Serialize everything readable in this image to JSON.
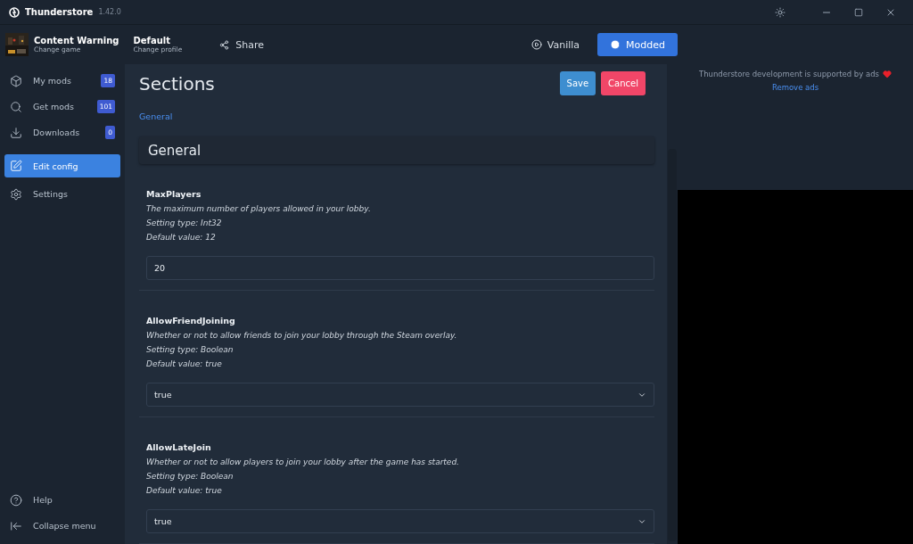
{
  "window": {
    "title": "Thunderstore",
    "version": "1.42.0"
  },
  "game": {
    "name": "Content Warning",
    "action": "Change game"
  },
  "profile": {
    "name": "Default",
    "action": "Change profile"
  },
  "share": "Share",
  "launch": [
    {
      "label": "Vanilla",
      "selected": false
    },
    {
      "label": "Modded",
      "selected": true
    }
  ],
  "sidebar": {
    "items": [
      {
        "kind": "mods",
        "label": "My mods",
        "badge": "18",
        "selected": false
      },
      {
        "kind": "search",
        "label": "Get mods",
        "badge": "101",
        "selected": false
      },
      {
        "kind": "download",
        "label": "Downloads",
        "badge": "0",
        "selected": false
      },
      {
        "kind": "edit",
        "label": "Edit config",
        "selected": true
      },
      {
        "kind": "settings",
        "label": "Settings",
        "selected": false
      }
    ],
    "footer": [
      {
        "kind": "help",
        "label": "Help"
      },
      {
        "kind": "collapse",
        "label": "Collapse menu"
      }
    ]
  },
  "content": {
    "title": "Sections",
    "buttons": [
      {
        "kind": "save",
        "label": "Save"
      },
      {
        "kind": "cancel",
        "label": "Cancel"
      }
    ],
    "section_links": [
      "General"
    ],
    "section_title": "General",
    "settings": [
      {
        "name": "MaxPlayers",
        "description": "The maximum number of players allowed in your lobby.",
        "type": "Setting type: Int32",
        "default": "Default value: 12",
        "kind": "input",
        "value": "20"
      },
      {
        "name": "AllowFriendJoining",
        "description": "Whether or not to allow friends to join your lobby through the Steam overlay.",
        "type": "Setting type: Boolean",
        "default": "Default value: true",
        "kind": "select",
        "value": "true"
      },
      {
        "name": "AllowLateJoin",
        "description": "Whether or not to allow players to join your lobby after the game has started.",
        "type": "Setting type: Boolean",
        "default": "Default value: true",
        "kind": "select",
        "value": "true"
      }
    ]
  },
  "ad": {
    "text": "Thunderstore development is supported by ads",
    "link": "Remove ads"
  }
}
